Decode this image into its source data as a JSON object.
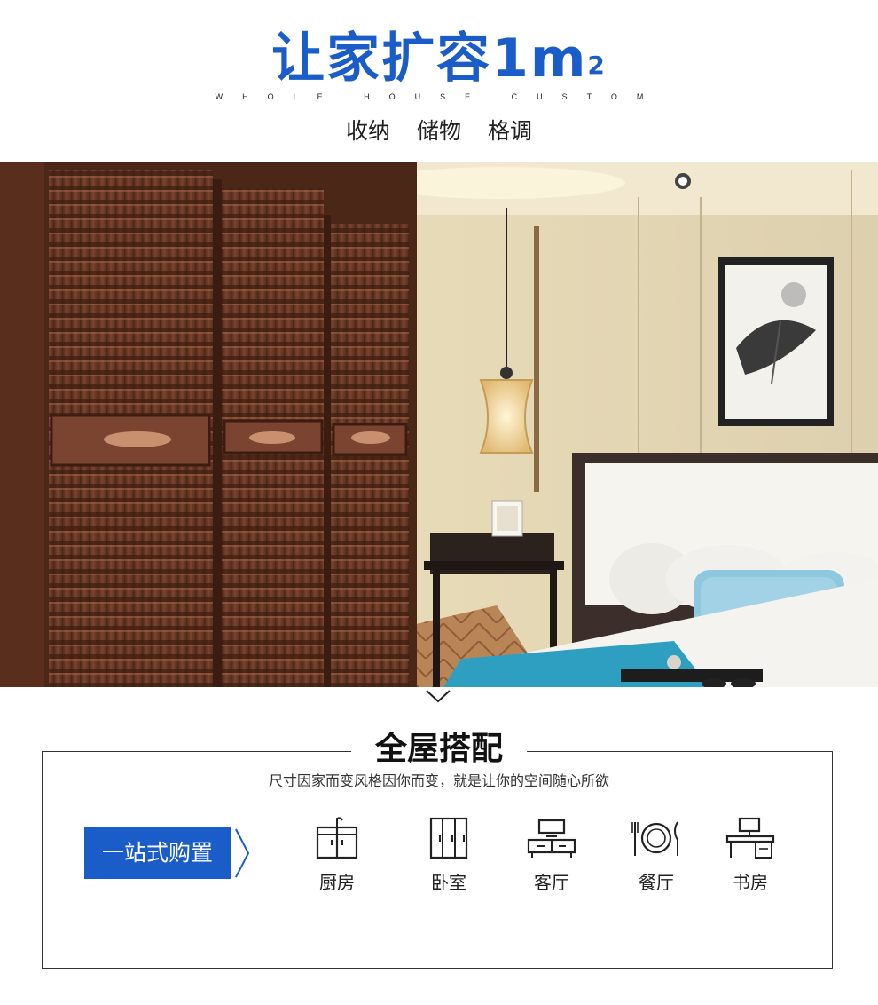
{
  "header": {
    "title": "让家扩容1m",
    "title_sup": "2",
    "subtitle": "WHOLE HOUSE CUSTOM",
    "tags": [
      "收纳",
      "储物",
      "格调"
    ]
  },
  "section": {
    "title": "全屋搭配",
    "description": "尺寸因家而变风格因你而变，就是让你的空间随心所欲",
    "cta_label": "一站式购置",
    "categories": [
      {
        "label": "厨房",
        "icon": "kitchen-cabinet-icon"
      },
      {
        "label": "卧室",
        "icon": "wardrobe-icon"
      },
      {
        "label": "客厅",
        "icon": "tv-stand-icon"
      },
      {
        "label": "餐厅",
        "icon": "plate-cutlery-icon"
      },
      {
        "label": "书房",
        "icon": "desk-computer-icon"
      }
    ]
  },
  "colors": {
    "accent": "#1a5cc8",
    "wood": "#6b3a24",
    "wall": "#e3d7b8",
    "bed_blue": "#2e9fc0"
  }
}
